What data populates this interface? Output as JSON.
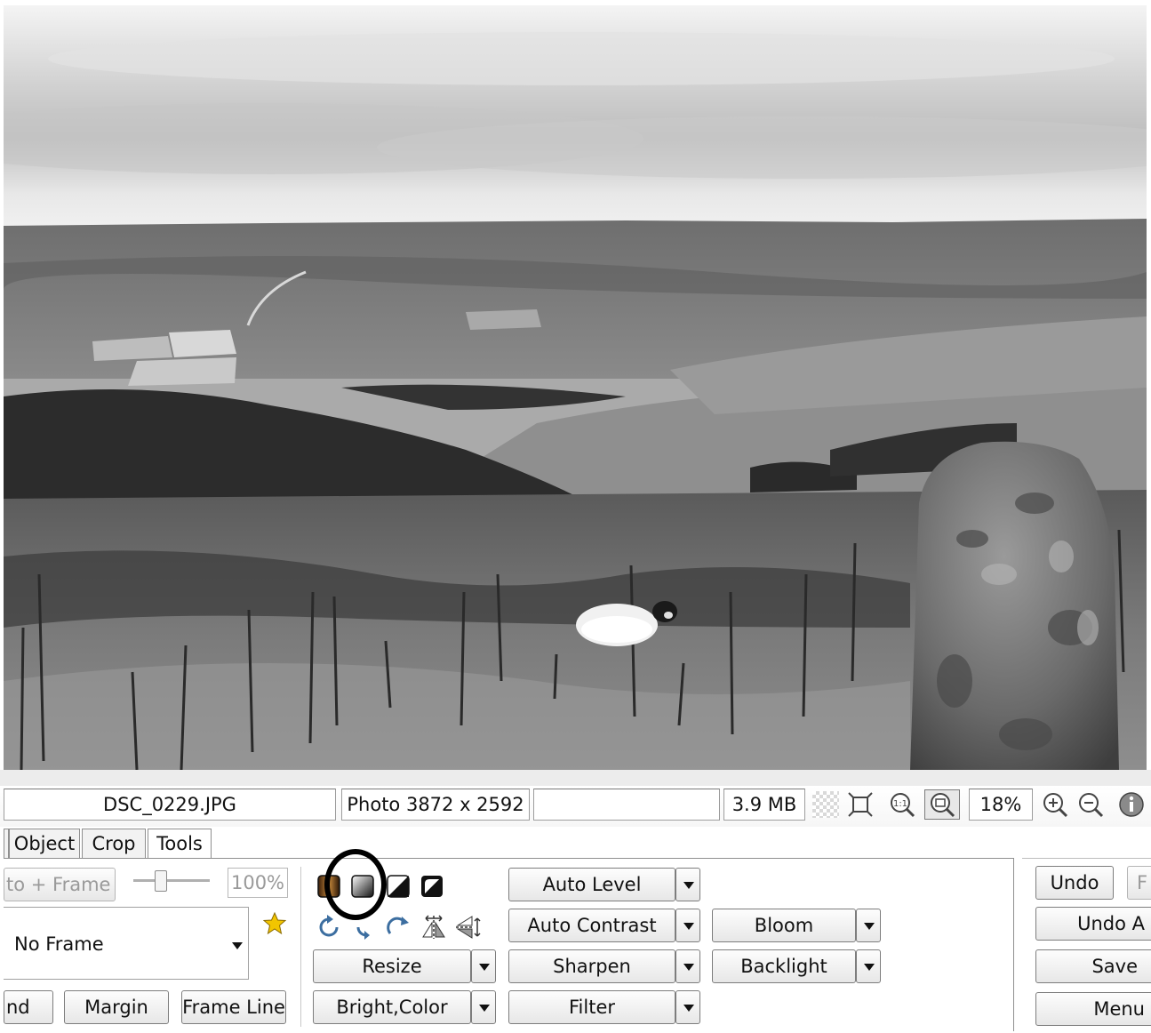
{
  "status_bar": {
    "filename": "DSC_0229.JPG",
    "dimensions": "Photo 3872 x 2592",
    "empty_field": "",
    "file_size": "3.9 MB",
    "zoom": "18%",
    "icons": [
      "checkerboard-icon",
      "fit-to-window-icon",
      "actual-size-icon",
      "zoom-fit-icon",
      "zoom-in-icon",
      "zoom-out-icon",
      "info-icon"
    ]
  },
  "tabs": [
    {
      "label": "Object"
    },
    {
      "label": "Crop"
    },
    {
      "label": "Tools"
    }
  ],
  "frame_panel": {
    "photo_frame_button": "to + Frame",
    "opacity_value": "100%",
    "frame_select": "No Frame",
    "background_button": "nd",
    "margin_button": "Margin",
    "frame_line_button": "Frame Line"
  },
  "effect_icons": [
    "sepia-icon",
    "grayscale-icon",
    "black-white-icon",
    "negative-icon",
    "rotate-left-icon",
    "rotate-right-icon",
    "rotate-clockwise-icon",
    "flip-horizontal-icon",
    "flip-vertical-icon"
  ],
  "tools": {
    "resize": "Resize",
    "bright_color": "Bright,Color",
    "auto_level": "Auto Level",
    "auto_contrast": "Auto Contrast",
    "sharpen": "Sharpen",
    "filter": "Filter",
    "bloom": "Bloom",
    "backlight": "Backlight"
  },
  "right_buttons": {
    "undo": "Undo",
    "redo_partial": "F",
    "undo_all": "Undo A",
    "save": "Save",
    "menu": "Menu"
  },
  "colors": {
    "accent_star": "#f2c500",
    "highlight_circle": "#000000"
  }
}
